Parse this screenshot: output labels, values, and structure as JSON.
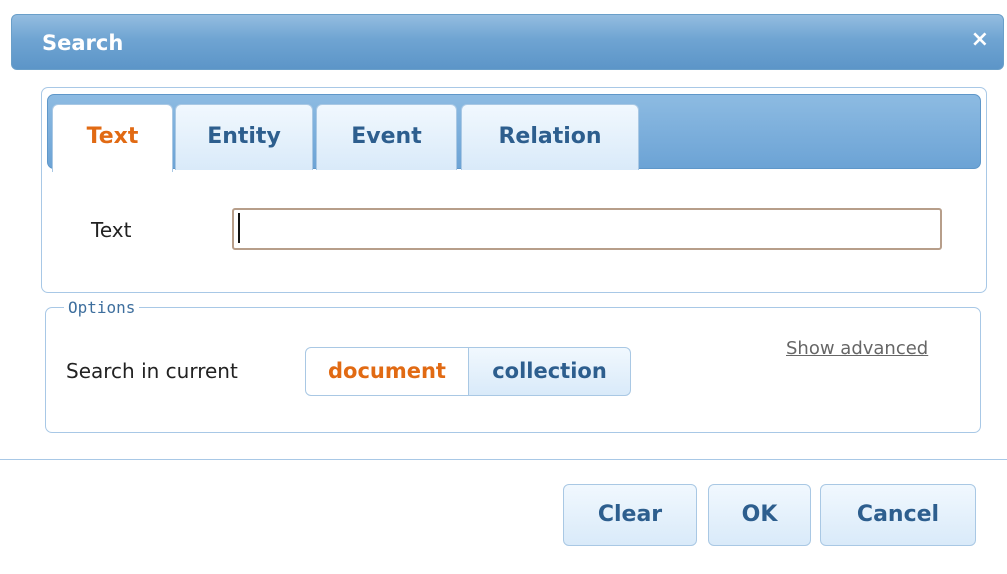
{
  "dialog": {
    "title": "Search",
    "close_icon": "×"
  },
  "tabs": [
    {
      "label": "Text",
      "active": true
    },
    {
      "label": "Entity",
      "active": false
    },
    {
      "label": "Event",
      "active": false
    },
    {
      "label": "Relation",
      "active": false
    }
  ],
  "text_field": {
    "label": "Text",
    "value": "",
    "placeholder": ""
  },
  "options": {
    "legend": "Options",
    "search_in_label": "Search in current",
    "scope": {
      "options": [
        "document",
        "collection"
      ],
      "selected": "document"
    },
    "show_advanced": "Show advanced"
  },
  "buttons": {
    "clear": "Clear",
    "ok": "OK",
    "cancel": "Cancel"
  },
  "colors": {
    "accent": "#e16a13",
    "title_bar": "#6fa4d2",
    "tab_text": "#2d5e8e"
  }
}
